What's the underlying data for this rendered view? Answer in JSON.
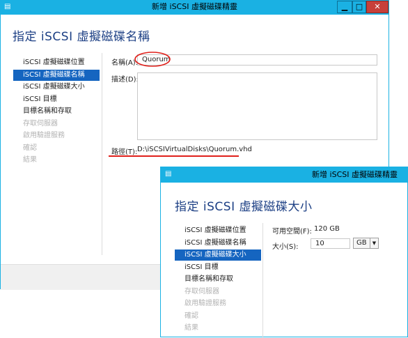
{
  "back_window": {
    "title": "新增 iSCSI 虛擬磁碟精靈",
    "page_title": "指定 iSCSI 虛擬磁碟名稱",
    "nav": [
      {
        "label": "iSCSI 虛擬磁碟位置",
        "state": "normal"
      },
      {
        "label": "iSCSI 虛擬磁碟名稱",
        "state": "active"
      },
      {
        "label": "iSCSI 虛擬磁碟大小",
        "state": "normal"
      },
      {
        "label": "iSCSI 目標",
        "state": "normal"
      },
      {
        "label": "目標名稱和存取",
        "state": "normal"
      },
      {
        "label": "存取伺服器",
        "state": "disabled"
      },
      {
        "label": "啟用驗證服務",
        "state": "disabled"
      },
      {
        "label": "確認",
        "state": "disabled"
      },
      {
        "label": "結果",
        "state": "disabled"
      }
    ],
    "name_label": "名稱(A):",
    "name_value": "Quorum",
    "description_label": "描述(D):",
    "description_value": "",
    "path_label": "路徑(T):",
    "path_value": "D:\\iSCSIVirtualDisks\\Quorum.vhd",
    "buttons": {
      "minimize": "▁",
      "maximize": "□",
      "close": "✕"
    }
  },
  "front_window": {
    "title": "新增 iSCSI 虛擬磁碟精靈",
    "page_title": "指定 iSCSI 虛擬磁碟大小",
    "nav": [
      {
        "label": "iSCSI 虛擬磁碟位置",
        "state": "normal"
      },
      {
        "label": "iSCSI 虛擬磁碟名稱",
        "state": "normal"
      },
      {
        "label": "iSCSI 虛擬磁碟大小",
        "state": "active"
      },
      {
        "label": "iSCSI 目標",
        "state": "normal"
      },
      {
        "label": "目標名稱和存取",
        "state": "normal"
      },
      {
        "label": "存取伺服器",
        "state": "disabled"
      },
      {
        "label": "啟用驗證服務",
        "state": "disabled"
      },
      {
        "label": "確認",
        "state": "disabled"
      },
      {
        "label": "結果",
        "state": "disabled"
      }
    ],
    "free_space_label": "可用空間(F):",
    "free_space_value": "120 GB",
    "size_label": "大小(S):",
    "size_value": "10",
    "unit_value": "GB"
  },
  "colors": {
    "title_bar": "#1ab1e3",
    "heading": "#1c3f84",
    "nav_active": "#1565c0",
    "annotation": "#e0201b"
  }
}
